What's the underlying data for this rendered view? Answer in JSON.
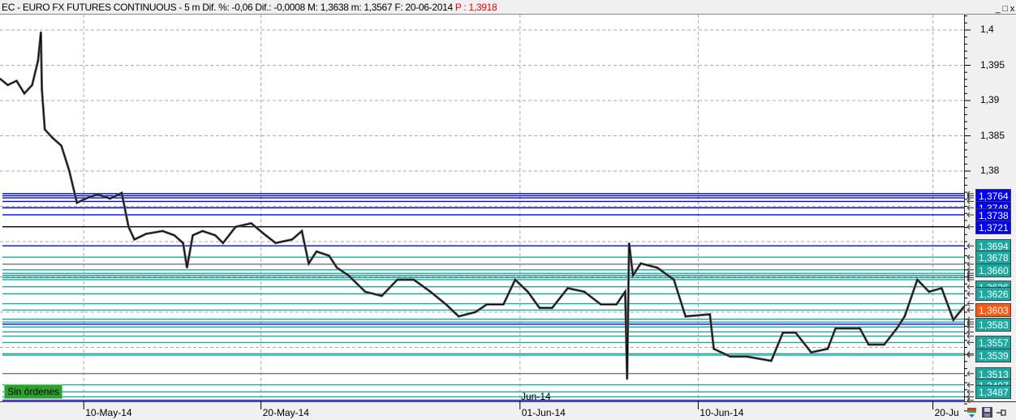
{
  "header": {
    "title": "EC - EURO FX FUTURES CONTINUOUS -  5 m  Dif. %: -0,06  Dif.: -0,0008  M: 1,3638  m: 1,3567  F: 20-06-2014",
    "last_price": "P : 1,3918"
  },
  "window_buttons": {
    "minimize": "_",
    "maximize": "□",
    "close": "x"
  },
  "orders_badge": "Sin órdenes",
  "month_marker": "Jun-14",
  "colors": {
    "price_line": "#000000",
    "blue_level": "#0000ff",
    "teal_level": "#1aa9a0",
    "current_price": "#ff5a10",
    "orders_badge": "#2ea02e"
  },
  "chart_data": {
    "type": "line",
    "title": "EC - EURO FX FUTURES CONTINUOUS - 5 m",
    "ylim": [
      1.3455,
      1.4021
    ],
    "xlim": [
      0,
      99
    ],
    "yticks": [
      1.4,
      1.395,
      1.39,
      1.385,
      1.38
    ],
    "ytick_labels": [
      "1,4",
      "1,395",
      "1,39",
      "1,385",
      "1,38"
    ],
    "xticks": [
      {
        "x": 8.6,
        "label": "10-May-14"
      },
      {
        "x": 26.8,
        "label": "20-May-14"
      },
      {
        "x": 53.4,
        "label": "01-Jun-14"
      },
      {
        "x": 71.7,
        "label": "10-Jun-14"
      },
      {
        "x": 95.8,
        "label": "20-Ju"
      }
    ],
    "grid": true,
    "series": [
      {
        "name": "EC 5m",
        "points": [
          [
            0,
            1.3931
          ],
          [
            0.8,
            1.3922
          ],
          [
            1.7,
            1.3928
          ],
          [
            2.5,
            1.391
          ],
          [
            3.3,
            1.3922
          ],
          [
            3.9,
            1.3956
          ],
          [
            4.2,
            1.3997
          ],
          [
            4.3,
            1.3916
          ],
          [
            4.6,
            1.3859
          ],
          [
            5.4,
            1.3847
          ],
          [
            6.3,
            1.3836
          ],
          [
            7.1,
            1.3801
          ],
          [
            7.9,
            1.3755
          ],
          [
            8.8,
            1.3761
          ],
          [
            10,
            1.3767
          ],
          [
            11.3,
            1.3761
          ],
          [
            12.5,
            1.3769
          ],
          [
            13.2,
            1.3721
          ],
          [
            13.8,
            1.3703
          ],
          [
            15,
            1.3711
          ],
          [
            16.7,
            1.3715
          ],
          [
            17.9,
            1.3709
          ],
          [
            18.8,
            1.3698
          ],
          [
            19.2,
            1.3663
          ],
          [
            19.8,
            1.3709
          ],
          [
            20.8,
            1.3715
          ],
          [
            22.1,
            1.3709
          ],
          [
            22.9,
            1.3698
          ],
          [
            24.2,
            1.3721
          ],
          [
            25.8,
            1.3726
          ],
          [
            27.1,
            1.3711
          ],
          [
            28.3,
            1.3698
          ],
          [
            30,
            1.3703
          ],
          [
            31,
            1.3715
          ],
          [
            31.7,
            1.3669
          ],
          [
            32.5,
            1.3686
          ],
          [
            33.8,
            1.368
          ],
          [
            34.6,
            1.3663
          ],
          [
            35.8,
            1.3652
          ],
          [
            37.5,
            1.3629
          ],
          [
            39.2,
            1.3623
          ],
          [
            40.8,
            1.3646
          ],
          [
            42.5,
            1.3646
          ],
          [
            44.2,
            1.3629
          ],
          [
            45.8,
            1.3611
          ],
          [
            47.1,
            1.3594
          ],
          [
            48.8,
            1.36
          ],
          [
            50,
            1.3611
          ],
          [
            51.7,
            1.3611
          ],
          [
            52.9,
            1.3646
          ],
          [
            54.2,
            1.3629
          ],
          [
            55.4,
            1.3606
          ],
          [
            56.7,
            1.3606
          ],
          [
            58.3,
            1.3634
          ],
          [
            60,
            1.3629
          ],
          [
            61.7,
            1.3611
          ],
          [
            63.3,
            1.3611
          ],
          [
            64.2,
            1.3629
          ],
          [
            64.4,
            1.3505
          ],
          [
            64.6,
            1.3698
          ],
          [
            65,
            1.3652
          ],
          [
            65.8,
            1.3669
          ],
          [
            67.5,
            1.3663
          ],
          [
            69.2,
            1.3646
          ],
          [
            70.4,
            1.3594
          ],
          [
            72.9,
            1.3597
          ],
          [
            73.3,
            1.3548
          ],
          [
            75,
            1.3537
          ],
          [
            76.7,
            1.3537
          ],
          [
            79.2,
            1.3531
          ],
          [
            80.4,
            1.3571
          ],
          [
            81.7,
            1.3571
          ],
          [
            83.3,
            1.3543
          ],
          [
            85,
            1.3548
          ],
          [
            85.8,
            1.3577
          ],
          [
            88.3,
            1.3577
          ],
          [
            89.2,
            1.3554
          ],
          [
            90.8,
            1.3554
          ],
          [
            92.1,
            1.3577
          ],
          [
            92.9,
            1.3594
          ],
          [
            94.2,
            1.3646
          ],
          [
            95.4,
            1.3629
          ],
          [
            96.7,
            1.3634
          ],
          [
            97.9,
            1.3589
          ],
          [
            99,
            1.3608
          ]
        ]
      }
    ],
    "levels": [
      {
        "price": 1.3768,
        "color": "blue",
        "label": ""
      },
      {
        "price": 1.3765,
        "color": "blue",
        "label": "1,3764"
      },
      {
        "price": 1.3762,
        "color": "blue",
        "label": ""
      },
      {
        "price": 1.3757,
        "color": "blue",
        "label": ""
      },
      {
        "price": 1.3748,
        "color": "blue",
        "label": "1,3748"
      },
      {
        "price": 1.3738,
        "color": "blue",
        "label": "1,3738"
      },
      {
        "price": 1.3721,
        "color": "black",
        "label": "1,3721"
      },
      {
        "price": 1.3694,
        "color": "blue",
        "label": "1,3694"
      },
      {
        "price": 1.3678,
        "color": "teal",
        "label": "1,3678"
      },
      {
        "price": 1.3668,
        "color": "gray",
        "label": ""
      },
      {
        "price": 1.366,
        "color": "teal",
        "label": "1,3660"
      },
      {
        "price": 1.3655,
        "color": "teal",
        "label": ""
      },
      {
        "price": 1.3652,
        "color": "teal",
        "label": ""
      },
      {
        "price": 1.3649,
        "color": "teal",
        "label": ""
      },
      {
        "price": 1.3646,
        "color": "teal",
        "label": ""
      },
      {
        "price": 1.3636,
        "color": "teal",
        "label": "1,3636"
      },
      {
        "price": 1.3626,
        "color": "teal",
        "label": "1,3626"
      },
      {
        "price": 1.3612,
        "color": "teal",
        "label": ""
      },
      {
        "price": 1.3603,
        "color": "teal",
        "label": ""
      },
      {
        "price": 1.359,
        "color": "teal",
        "label": ""
      },
      {
        "price": 1.3586,
        "color": "teal",
        "label": ""
      },
      {
        "price": 1.3583,
        "color": "blue",
        "label": "1,3583"
      },
      {
        "price": 1.3579,
        "color": "teal",
        "label": ""
      },
      {
        "price": 1.3572,
        "color": "teal",
        "label": ""
      },
      {
        "price": 1.3566,
        "color": "teal",
        "label": ""
      },
      {
        "price": 1.3557,
        "color": "teal",
        "label": "1,3557"
      },
      {
        "price": 1.3541,
        "color": "teal",
        "label": ""
      },
      {
        "price": 1.3539,
        "color": "teal",
        "label": "1,3539"
      },
      {
        "price": 1.3513,
        "color": "gray",
        "label": "1,3513"
      },
      {
        "price": 1.3497,
        "color": "teal",
        "label": "1,3497"
      },
      {
        "price": 1.3487,
        "color": "teal",
        "label": "1,3487"
      },
      {
        "price": 1.348,
        "color": "teal",
        "label": ""
      },
      {
        "price": 1.3475,
        "color": "blue",
        "label": ""
      }
    ],
    "current_price": {
      "price": 1.3603,
      "label": "1,3603"
    }
  }
}
